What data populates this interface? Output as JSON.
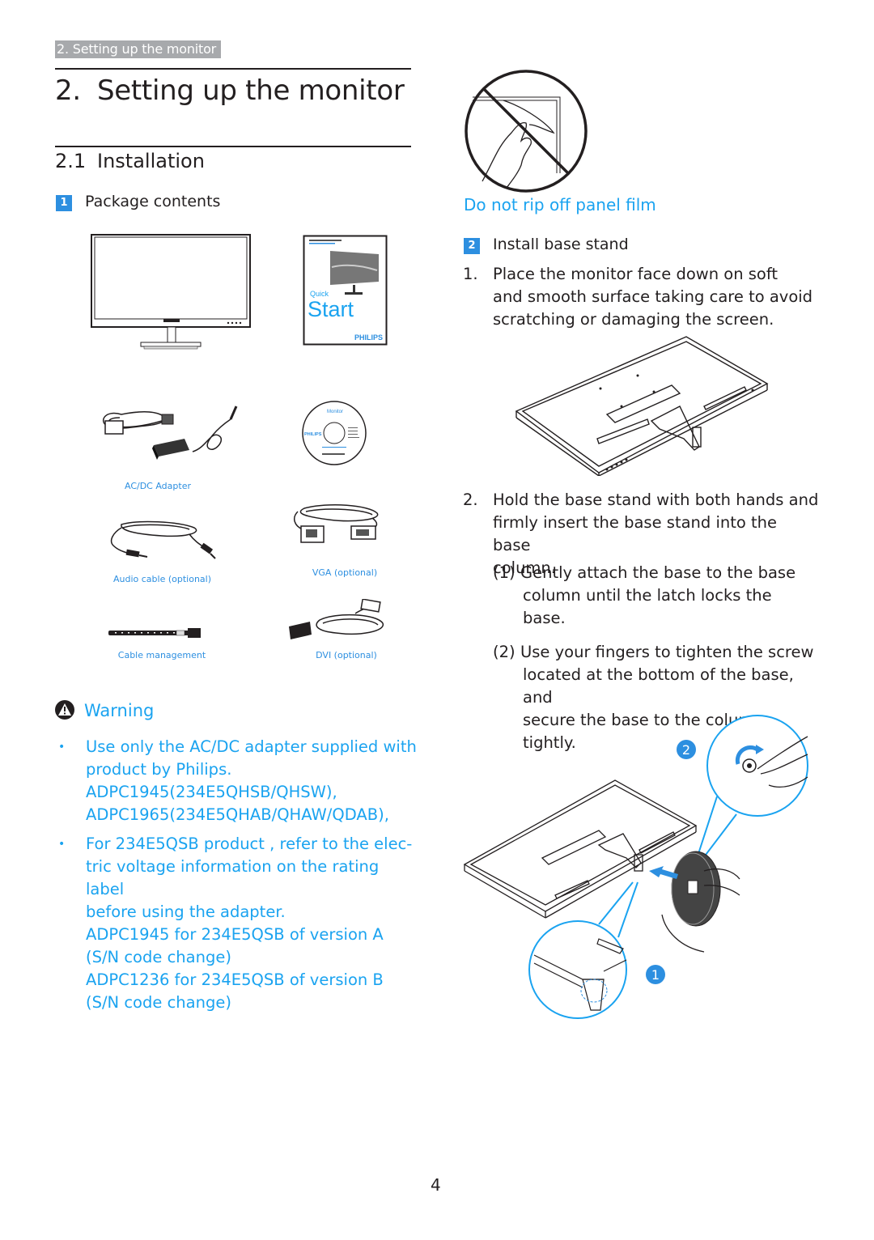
{
  "running_head": "2. Setting up the monitor",
  "chapter": {
    "number": "2.",
    "title": "Setting up the monitor"
  },
  "section": {
    "number": "2.1",
    "title": "Installation"
  },
  "step1": {
    "badge": "1",
    "title": "Package contents",
    "items": [
      {
        "icon": "monitor-icon",
        "label": ""
      },
      {
        "icon": "quick-start-guide-icon",
        "label": "",
        "cover_small": "Quick",
        "cover_big": "Start",
        "cover_brand": "PHILIPS"
      },
      {
        "icon": "ac-dc-adapter-icon",
        "label": "AC/DC Adapter"
      },
      {
        "icon": "cd-rom-icon",
        "label": "",
        "disc_brand": "PHILIPS",
        "disc_title": "Monitor"
      },
      {
        "icon": "audio-cable-icon",
        "label": "Audio cable (optional)"
      },
      {
        "icon": "vga-cable-icon",
        "label": "VGA (optional)"
      },
      {
        "icon": "cable-tie-icon",
        "label": "Cable management"
      },
      {
        "icon": "dvi-cable-icon",
        "label": "DVI (optional)"
      }
    ]
  },
  "warning": {
    "title": "Warning",
    "bullets": [
      {
        "lines": [
          "Use only the AC/DC adapter supplied with",
          "product by Philips.",
          "ADPC1945(234E5QHSB/QHSW),",
          "ADPC1965(234E5QHAB/QHAW/QDAB),"
        ]
      },
      {
        "lines": [
          "For 234E5QSB product , refer to the elec-",
          "tric voltage information on the rating label",
          "before using the adapter.",
          "ADPC1945 for 234E5QSB of version A",
          "(S/N code change)",
          "ADPC1236 for 234E5QSB of version B",
          "(S/N code change)"
        ]
      }
    ]
  },
  "film_warning": {
    "caption": "Do not rip off panel film",
    "icon": "no-peel-film-icon"
  },
  "step2": {
    "badge": "2",
    "title": "Install base stand",
    "steps": [
      {
        "n": "1.",
        "lines": [
          "Place the monitor face down on soft",
          "and smooth surface taking care to avoid",
          "scratching or damaging the screen."
        ]
      },
      {
        "n": "2.",
        "lines": [
          "Hold the base stand with both hands and",
          "firmly insert the base stand into the base",
          "column."
        ],
        "sub": [
          {
            "n": "(1)",
            "lines": [
              "Gently attach the base to the base",
              "column until the latch locks the base."
            ]
          },
          {
            "n": "(2)",
            "lines": [
              "Use your fingers to tighten the screw",
              "located at the bottom of the base, and",
              "secure the base to the column tightly."
            ]
          }
        ]
      }
    ],
    "diagram_callouts": [
      "1",
      "2"
    ]
  },
  "page_number": "4",
  "colors": {
    "accent": "#1aa3f0",
    "badge": "#2d8fe0",
    "text": "#231f20",
    "running_head_bg": "#a7a9ac"
  }
}
